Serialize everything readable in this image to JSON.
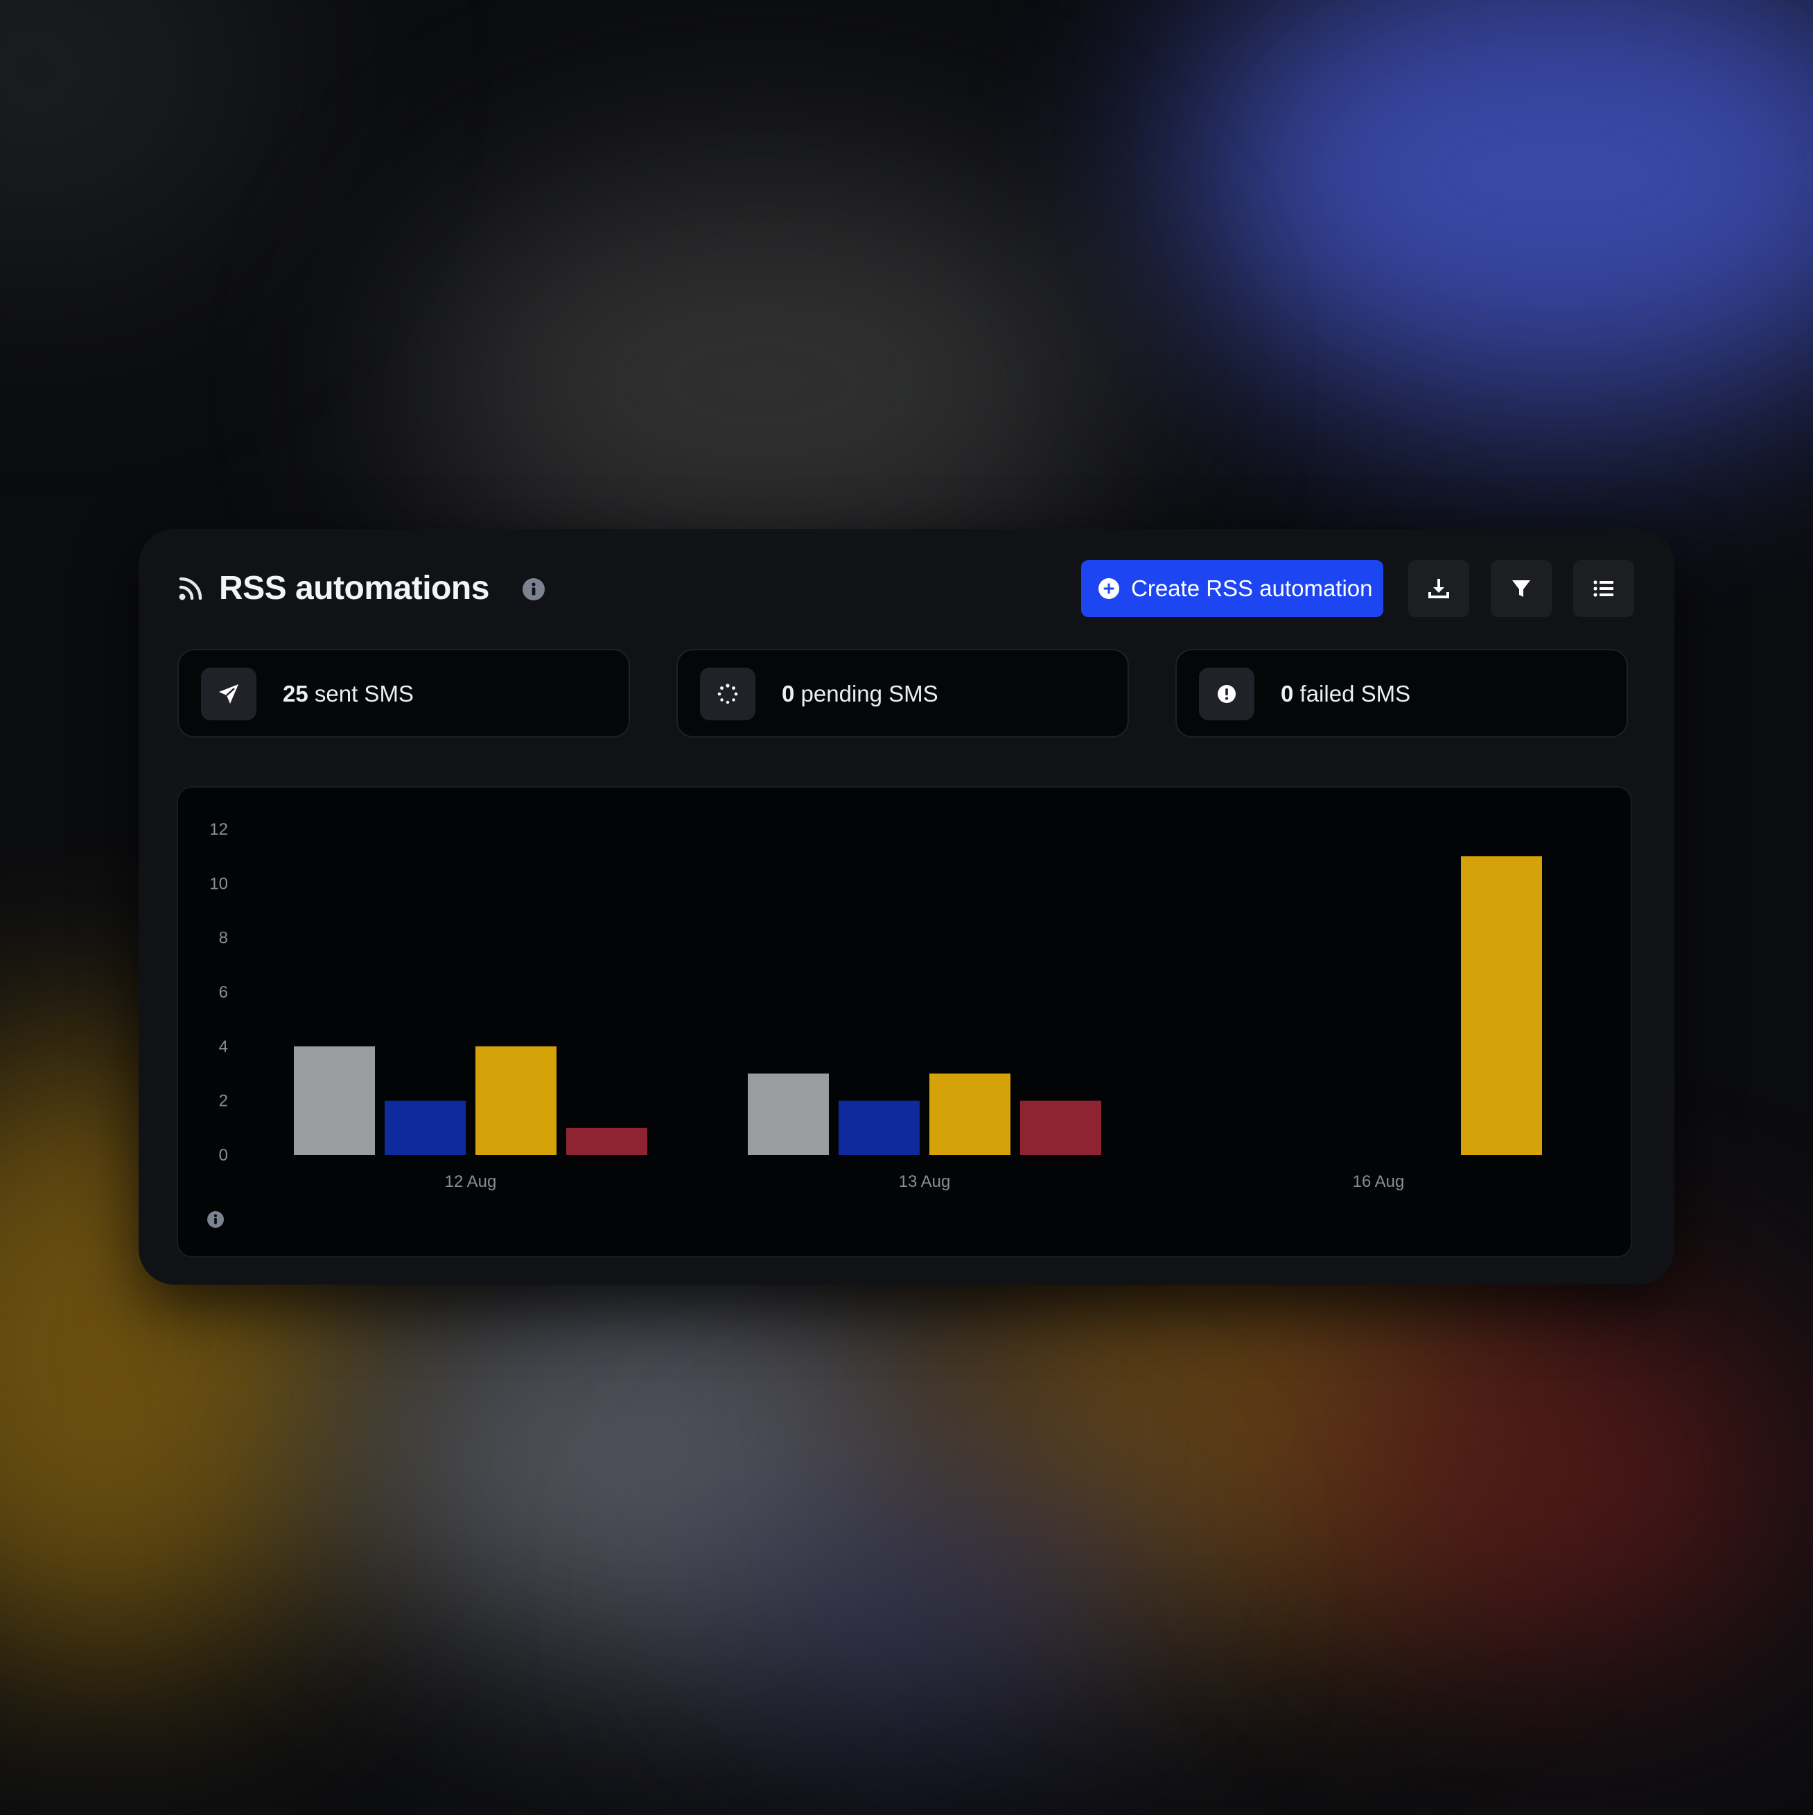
{
  "header": {
    "title": "RSS automations",
    "create_label": "Create RSS automation",
    "icons": [
      "rss-icon",
      "info-icon",
      "plus-circle-icon",
      "download-icon",
      "filter-icon",
      "list-icon"
    ]
  },
  "stats": [
    {
      "count": "25",
      "label": "sent SMS",
      "icon": "paper-plane-icon"
    },
    {
      "count": "0",
      "label": "pending SMS",
      "icon": "spinner-icon"
    },
    {
      "count": "0",
      "label": "failed SMS",
      "icon": "alert-circle-icon"
    }
  ],
  "chart_data": {
    "type": "bar",
    "categories": [
      "12 Aug",
      "13 Aug",
      "16 Aug"
    ],
    "yticks": [
      "0",
      "2",
      "4",
      "6",
      "8",
      "10",
      "12"
    ],
    "ylim": [
      0,
      12
    ],
    "series": [
      {
        "values": [
          4,
          3,
          0
        ],
        "color": "#9b9ca0"
      },
      {
        "values": [
          2,
          2,
          0
        ],
        "color": "#0f2a9c"
      },
      {
        "values": [
          4,
          3,
          11
        ],
        "color": "#d6a20a"
      },
      {
        "values": [
          1,
          2,
          0
        ],
        "color": "#8e2432"
      }
    ]
  },
  "colors": {
    "accent": "#1d46f2",
    "card": "#111216",
    "chart_bg": "#030406"
  }
}
